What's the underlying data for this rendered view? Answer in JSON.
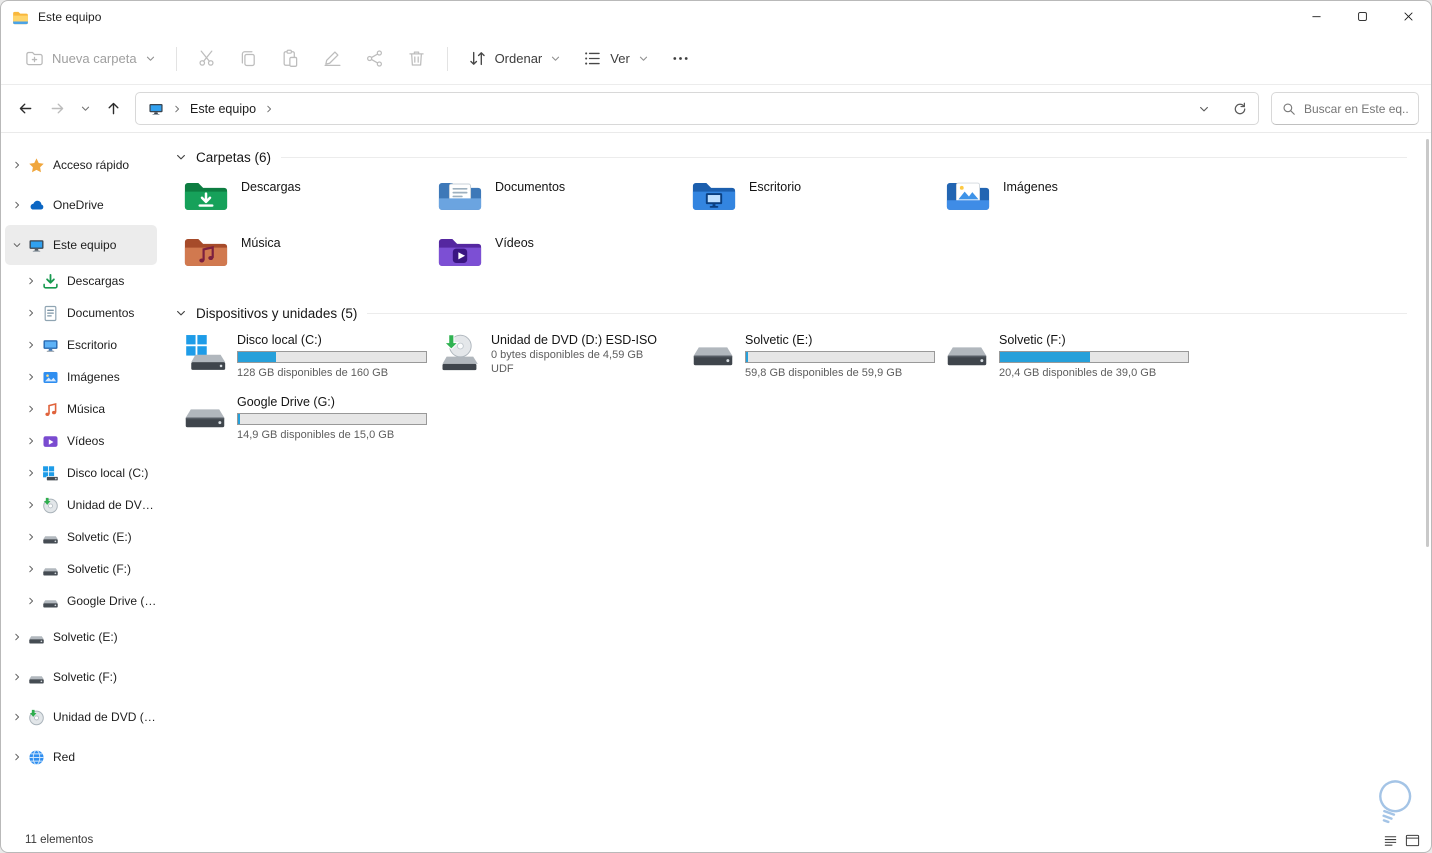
{
  "window": {
    "title": "Este equipo"
  },
  "toolbar": {
    "new_folder_label": "Nueva carpeta",
    "sort_label": "Ordenar",
    "view_label": "Ver"
  },
  "navbar": {
    "breadcrumb_root": "Este equipo",
    "search_placeholder": "Buscar en Este eq..."
  },
  "sidebar": {
    "items": [
      {
        "label": "Acceso rápido",
        "icon": "star-icon",
        "level": 0,
        "expanded": false,
        "selected": false
      },
      {
        "label": "OneDrive",
        "icon": "onedrive-cloud-icon",
        "level": 0,
        "expanded": false,
        "selected": false
      },
      {
        "label": "Este equipo",
        "icon": "computer-icon",
        "level": 0,
        "expanded": true,
        "selected": true
      },
      {
        "label": "Descargas",
        "icon": "downloads-icon",
        "level": 1,
        "expanded": false,
        "selected": false
      },
      {
        "label": "Documentos",
        "icon": "documents-icon",
        "level": 1,
        "expanded": false,
        "selected": false
      },
      {
        "label": "Escritorio",
        "icon": "desktop-icon",
        "level": 1,
        "expanded": false,
        "selected": false
      },
      {
        "label": "Imágenes",
        "icon": "pictures-icon",
        "level": 1,
        "expanded": false,
        "selected": false
      },
      {
        "label": "Música",
        "icon": "music-icon",
        "level": 1,
        "expanded": false,
        "selected": false
      },
      {
        "label": "Vídeos",
        "ic2": "",
        "icon": "videos-icon",
        "level": 1,
        "expanded": false,
        "selected": false
      },
      {
        "label": "Disco local (C:)",
        "icon": "system-drive-icon",
        "level": 1,
        "expanded": false,
        "selected": false
      },
      {
        "label": "Unidad de DVD (D:",
        "icon": "dvd-icon",
        "level": 1,
        "expanded": false,
        "selected": false
      },
      {
        "label": "Solvetic (E:)",
        "icon": "drive-icon",
        "level": 1,
        "expanded": false,
        "selected": false
      },
      {
        "label": "Solvetic (F:)",
        "icon": "drive-icon",
        "level": 1,
        "expanded": false,
        "selected": false
      },
      {
        "label": "Google Drive (G:)",
        "icon": "drive-icon",
        "level": 1,
        "expanded": false,
        "selected": false
      },
      {
        "label": "Solvetic (E:)",
        "icon": "drive-icon",
        "level": 0,
        "expanded": false,
        "selected": false
      },
      {
        "label": "Solvetic (F:)",
        "icon": "drive-icon",
        "level": 0,
        "expanded": false,
        "selected": false
      },
      {
        "label": "Unidad de DVD (D:)",
        "icon": "dvd-icon",
        "level": 0,
        "expanded": false,
        "selected": false
      },
      {
        "label": "Red",
        "icon": "network-icon",
        "level": 0,
        "expanded": false,
        "selected": false
      }
    ]
  },
  "main": {
    "folders_section": {
      "title": "Carpetas (6)",
      "items": [
        {
          "name": "Descargas",
          "icon": "downloads-folder-icon"
        },
        {
          "name": "Documentos",
          "icon": "documents-folder-icon"
        },
        {
          "name": "Escritorio",
          "icon": "desktop-folder-icon"
        },
        {
          "name": "Imágenes",
          "icon": "pictures-folder-icon"
        },
        {
          "name": "Música",
          "icon": "music-folder-icon"
        },
        {
          "name": "Vídeos",
          "icon": "videos-folder-icon"
        }
      ]
    },
    "drives_section": {
      "title": "Dispositivos y unidades (5)",
      "items": [
        {
          "name": "Disco local (C:)",
          "icon": "system-drive-main-icon",
          "capacity_text": "128 GB disponibles de 160 GB",
          "used_percent": 20,
          "has_bar": true
        },
        {
          "name": "Unidad de DVD (D:) ESD-ISO",
          "icon": "dvd-main-icon",
          "capacity_text": "0 bytes disponibles de 4,59 GB",
          "format_text": "UDF",
          "has_bar": false
        },
        {
          "name": "Solvetic (E:)",
          "icon": "drive-main-icon",
          "capacity_text": "59,8 GB disponibles de 59,9 GB",
          "used_percent": 1,
          "has_bar": true
        },
        {
          "name": "Solvetic (F:)",
          "icon": "drive-main-icon",
          "capacity_text": "20,4 GB disponibles de 39,0 GB",
          "used_percent": 48,
          "has_bar": true
        },
        {
          "name": "Google Drive (G:)",
          "icon": "drive-main-icon",
          "capacity_text": "14,9 GB disponibles de 15,0 GB",
          "used_percent": 1,
          "has_bar": true
        }
      ]
    }
  },
  "statusbar": {
    "items_count": "11 elementos"
  },
  "colors": {
    "progress_fill": "#26a0da",
    "selection_bg": "#ececec"
  }
}
